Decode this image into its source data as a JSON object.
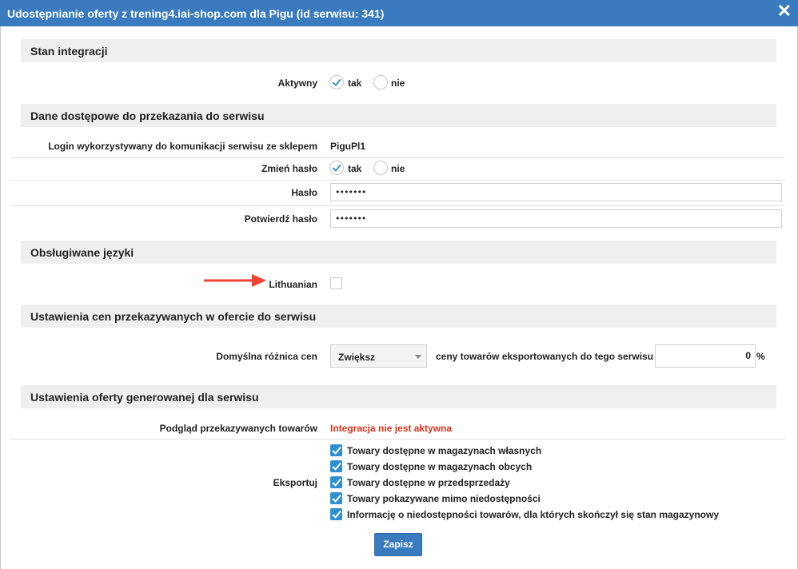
{
  "dialog": {
    "title": "Udostępnianie oferty z trening4.iai-shop.com dla Pigu (id serwisu: 341)",
    "close_label": "✕"
  },
  "integration": {
    "heading": "Stan integracji",
    "active_label": "Aktywny",
    "yes": "tak",
    "no": "nie",
    "active_selected": "tak"
  },
  "access": {
    "heading": "Dane dostępowe do przekazania do serwisu",
    "login_label": "Login wykorzystywany do komunikacji serwisu ze sklepem",
    "login_value": "PiguPl1",
    "change_password_label": "Zmień hasło",
    "yes": "tak",
    "no": "nie",
    "change_password_selected": "tak",
    "password_label": "Hasło",
    "password_value": "•••••••",
    "confirm_label": "Potwierdź hasło",
    "confirm_value": "•••••••"
  },
  "languages": {
    "heading": "Obsługiwane języki",
    "items": [
      {
        "label": "Lithuanian",
        "checked": false
      }
    ]
  },
  "pricing": {
    "heading": "Ustawienia cen przekazywanych w ofercie do serwisu",
    "diff_label": "Domyślna różnica cen",
    "select_value": "Zwiększ",
    "middle_text": "ceny towarów eksportowanych do tego serwisu o",
    "percent_value": "0",
    "percent_unit": "%"
  },
  "offer": {
    "heading": "Ustawienia oferty generowanej dla serwisu",
    "preview_label": "Podgląd przekazywanych towarów",
    "preview_status": "Integracja nie jest aktywna",
    "export_label": "Eksportuj",
    "export_items": [
      {
        "label": "Towary dostępne w magazynach własnych",
        "checked": true
      },
      {
        "label": "Towary dostępne w magazynach obcych",
        "checked": true
      },
      {
        "label": "Towary dostępne w przedsprzedaży",
        "checked": true
      },
      {
        "label": "Towary pokazywane mimo niedostępności",
        "checked": true
      },
      {
        "label": "Informację o niedostępności towarów, dla których skończył się stan magazynowy",
        "checked": true
      }
    ]
  },
  "save_label": "Zapisz",
  "colors": {
    "titlebar": "#3a7bbf",
    "accent": "#2f8fd0",
    "status_red": "#e0321a",
    "annotation_arrow": "#ef4433"
  }
}
